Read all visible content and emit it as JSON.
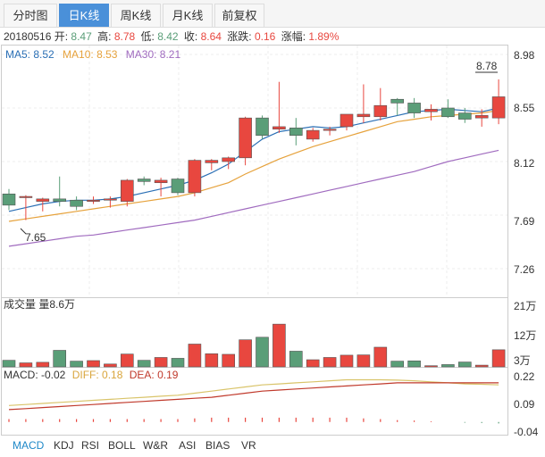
{
  "tabs": [
    "分时图",
    "日K线",
    "周K线",
    "月K线",
    "前复权"
  ],
  "active_tab": 1,
  "info_line": {
    "date": "20180516",
    "open_label": "开:",
    "open": "8.47",
    "high_label": "高:",
    "high": "8.78",
    "low_label": "低:",
    "low": "8.42",
    "close_label": "收:",
    "close": "8.64",
    "change_label": "涨跌:",
    "change": "0.16",
    "pct_label": "涨幅:",
    "pct": "1.89%"
  },
  "ma_legend": [
    {
      "text": "MA5: 8.52",
      "color": "#2a6fb5"
    },
    {
      "text": "MA10: 8.53",
      "color": "#e6a23c"
    },
    {
      "text": "MA30: 8.21",
      "color": "#a06bbf"
    }
  ],
  "colors": {
    "up": "#e8473f",
    "down": "#5a9e78",
    "ma5": "#2a6fb5",
    "ma10": "#e6a23c",
    "ma30": "#a06bbf",
    "diff": "#d9c46a",
    "dea": "#c0392b"
  },
  "price_axis": {
    "ticks": [
      "8.98",
      "8.55",
      "8.12",
      "7.69",
      "7.26"
    ],
    "values": [
      8.98,
      8.55,
      8.12,
      7.69,
      7.26
    ]
  },
  "volume_title": "成交量 量8.6万",
  "volume_axis": {
    "ticks": [
      "21万",
      "12万",
      "3万"
    ],
    "values": [
      21,
      12,
      3
    ]
  },
  "macd_line": {
    "macd_label": "MACD: -0.02",
    "macd_color": "#333333",
    "diff_label": "DIFF: 0.18",
    "diff_color": "#d9a53c",
    "dea_label": "DEA: 0.19",
    "dea_color": "#c0392b"
  },
  "macd_axis": {
    "ticks": [
      "0.22",
      "0.09",
      "-0.04"
    ],
    "values": [
      0.22,
      0.09,
      -0.04
    ]
  },
  "bottom_tabs": [
    "MACD",
    "KDJ",
    "RSI",
    "BOLL",
    "W&R",
    "ASI",
    "BIAS",
    "VR"
  ],
  "active_bottom_tab": 0,
  "chart_data": {
    "type": "candlestick",
    "candles": [
      {
        "o": 7.86,
        "h": 7.9,
        "l": 7.73,
        "c": 7.77
      },
      {
        "o": 7.83,
        "h": 7.85,
        "l": 7.65,
        "c": 7.84
      },
      {
        "o": 7.8,
        "h": 7.83,
        "l": 7.72,
        "c": 7.82
      },
      {
        "o": 7.82,
        "h": 8.0,
        "l": 7.76,
        "c": 7.8
      },
      {
        "o": 7.81,
        "h": 7.84,
        "l": 7.73,
        "c": 7.76
      },
      {
        "o": 7.8,
        "h": 7.84,
        "l": 7.78,
        "c": 7.81
      },
      {
        "o": 7.81,
        "h": 7.84,
        "l": 7.75,
        "c": 7.82
      },
      {
        "o": 7.8,
        "h": 7.98,
        "l": 7.76,
        "c": 7.97
      },
      {
        "o": 7.98,
        "h": 8.0,
        "l": 7.93,
        "c": 7.96
      },
      {
        "o": 7.95,
        "h": 7.99,
        "l": 7.84,
        "c": 7.97
      },
      {
        "o": 7.98,
        "h": 7.99,
        "l": 7.85,
        "c": 7.87
      },
      {
        "o": 7.87,
        "h": 8.14,
        "l": 7.84,
        "c": 8.13
      },
      {
        "o": 8.11,
        "h": 8.14,
        "l": 8.05,
        "c": 8.13
      },
      {
        "o": 8.12,
        "h": 8.16,
        "l": 8.06,
        "c": 8.15
      },
      {
        "o": 8.15,
        "h": 8.48,
        "l": 8.09,
        "c": 8.47
      },
      {
        "o": 8.47,
        "h": 8.49,
        "l": 8.3,
        "c": 8.33
      },
      {
        "o": 8.38,
        "h": 8.76,
        "l": 8.35,
        "c": 8.4
      },
      {
        "o": 8.39,
        "h": 8.47,
        "l": 8.25,
        "c": 8.33
      },
      {
        "o": 8.3,
        "h": 8.39,
        "l": 8.28,
        "c": 8.37
      },
      {
        "o": 8.37,
        "h": 8.4,
        "l": 8.33,
        "c": 8.38
      },
      {
        "o": 8.4,
        "h": 8.5,
        "l": 8.37,
        "c": 8.5
      },
      {
        "o": 8.48,
        "h": 8.74,
        "l": 8.43,
        "c": 8.5
      },
      {
        "o": 8.48,
        "h": 8.71,
        "l": 8.45,
        "c": 8.57
      },
      {
        "o": 8.62,
        "h": 8.63,
        "l": 8.49,
        "c": 8.59
      },
      {
        "o": 8.59,
        "h": 8.63,
        "l": 8.47,
        "c": 8.51
      },
      {
        "o": 8.52,
        "h": 8.58,
        "l": 8.45,
        "c": 8.54
      },
      {
        "o": 8.55,
        "h": 8.62,
        "l": 8.47,
        "c": 8.48
      },
      {
        "o": 8.51,
        "h": 8.55,
        "l": 8.43,
        "c": 8.46
      },
      {
        "o": 8.47,
        "h": 8.54,
        "l": 8.4,
        "c": 8.49
      },
      {
        "o": 8.47,
        "h": 8.78,
        "l": 8.42,
        "c": 8.64
      }
    ],
    "high_label": "8.78",
    "low_label": "7.65",
    "ma5": [
      7.72,
      7.75,
      7.78,
      7.8,
      7.81,
      7.81,
      7.82,
      7.84,
      7.87,
      7.9,
      7.93,
      7.97,
      8.03,
      8.1,
      8.2,
      8.3,
      8.36,
      8.38,
      8.4,
      8.39,
      8.4,
      8.43,
      8.46,
      8.49,
      8.52,
      8.53,
      8.54,
      8.53,
      8.52,
      8.55
    ],
    "ma10": [
      7.64,
      7.66,
      7.68,
      7.7,
      7.72,
      7.74,
      7.76,
      7.78,
      7.8,
      7.82,
      7.84,
      7.87,
      7.91,
      7.95,
      8.02,
      8.08,
      8.14,
      8.19,
      8.24,
      8.28,
      8.32,
      8.36,
      8.4,
      8.44,
      8.46,
      8.48,
      8.49,
      8.5,
      8.51,
      8.53
    ],
    "ma30": [
      7.44,
      7.46,
      7.48,
      7.5,
      7.52,
      7.53,
      7.55,
      7.57,
      7.59,
      7.61,
      7.63,
      7.65,
      7.68,
      7.71,
      7.74,
      7.77,
      7.8,
      7.83,
      7.86,
      7.89,
      7.92,
      7.95,
      7.98,
      8.01,
      8.04,
      8.08,
      8.12,
      8.15,
      8.18,
      8.21
    ],
    "volume_ylim": [
      0,
      21
    ],
    "volumes": [
      2.3,
      1.4,
      1.6,
      5.8,
      2.0,
      2.2,
      1.0,
      4.5,
      2.3,
      3.3,
      3.0,
      8.0,
      4.6,
      4.4,
      9.5,
      10.4,
      15.0,
      5.5,
      2.5,
      3.3,
      4.1,
      4.2,
      6.9,
      2.0,
      2.1,
      0.4,
      0.8,
      1.7,
      0.6,
      6.0
    ],
    "macd_ylim": [
      -0.04,
      0.22
    ],
    "diff": [
      0.08,
      0.085,
      0.09,
      0.095,
      0.1,
      0.105,
      0.11,
      0.115,
      0.12,
      0.125,
      0.13,
      0.14,
      0.15,
      0.16,
      0.17,
      0.18,
      0.185,
      0.19,
      0.195,
      0.2,
      0.205,
      0.205,
      0.205,
      0.203,
      0.2,
      0.195,
      0.19,
      0.185,
      0.183,
      0.18
    ],
    "dea": [
      0.06,
      0.065,
      0.07,
      0.075,
      0.08,
      0.085,
      0.09,
      0.095,
      0.1,
      0.105,
      0.11,
      0.115,
      0.12,
      0.13,
      0.14,
      0.15,
      0.155,
      0.16,
      0.165,
      0.17,
      0.175,
      0.18,
      0.185,
      0.19,
      0.19,
      0.19,
      0.19,
      0.19,
      0.19,
      0.19
    ],
    "macd_hist": [
      0.04,
      0.04,
      0.04,
      0.04,
      0.04,
      0.04,
      0.04,
      0.04,
      0.04,
      0.04,
      0.04,
      0.05,
      0.06,
      0.06,
      0.06,
      0.06,
      0.06,
      0.06,
      0.06,
      0.06,
      0.06,
      0.05,
      0.04,
      0.026,
      0.02,
      0.01,
      0.0,
      -0.01,
      -0.014,
      -0.02
    ]
  }
}
